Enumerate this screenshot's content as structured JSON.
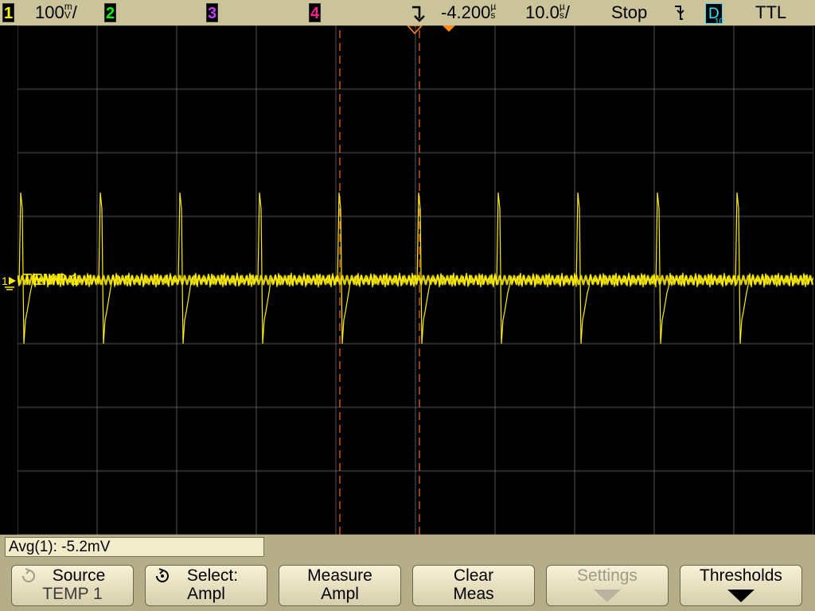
{
  "topbar": {
    "ch1": {
      "num": "1",
      "scale": "100",
      "unit_top": "m",
      "unit_bot": "V",
      "suffix": "/",
      "color": "#ffff00"
    },
    "ch2": {
      "num": "2",
      "color": "#00ff00"
    },
    "ch3": {
      "num": "3",
      "color": "#c040ff"
    },
    "ch4": {
      "num": "4",
      "color": "#ff2090"
    },
    "trigger_icon": "trigger-position-icon",
    "delay": "-4.200",
    "delay_unit": "s",
    "delay_unit_prefix": "µ",
    "timebase": "10.0",
    "timebase_unit_prefix": "µ",
    "timebase_unit": "s",
    "timebase_suffix": "/",
    "run_state": "Stop",
    "slope_icon": "falling-edge-icon",
    "trigger_source": "D",
    "trigger_source_sub": "10",
    "trigger_level": "TTL"
  },
  "trace": {
    "label": "TEMP 1",
    "marker": "1",
    "color": "#ffff00",
    "cursor_color": "#ff6a2a"
  },
  "readout": {
    "label": "Avg(1): -5.2mV"
  },
  "softkeys": [
    {
      "line1": "Source",
      "line2": "TEMP 1",
      "icon": "rotate-knob-icon",
      "enabled": true
    },
    {
      "line1": "Select:",
      "line2": "Ampl",
      "icon": "rotate-knob-icon",
      "enabled": true
    },
    {
      "line1": "Measure",
      "line2": "Ampl",
      "enabled": true
    },
    {
      "line1": "Clear",
      "line2": "Meas",
      "enabled": true
    },
    {
      "line1": "Settings",
      "line2": "",
      "icon": "down-arrow-icon",
      "enabled": false
    },
    {
      "line1": "Thresholds",
      "line2": "",
      "icon": "down-arrow-icon",
      "enabled": true
    }
  ]
}
